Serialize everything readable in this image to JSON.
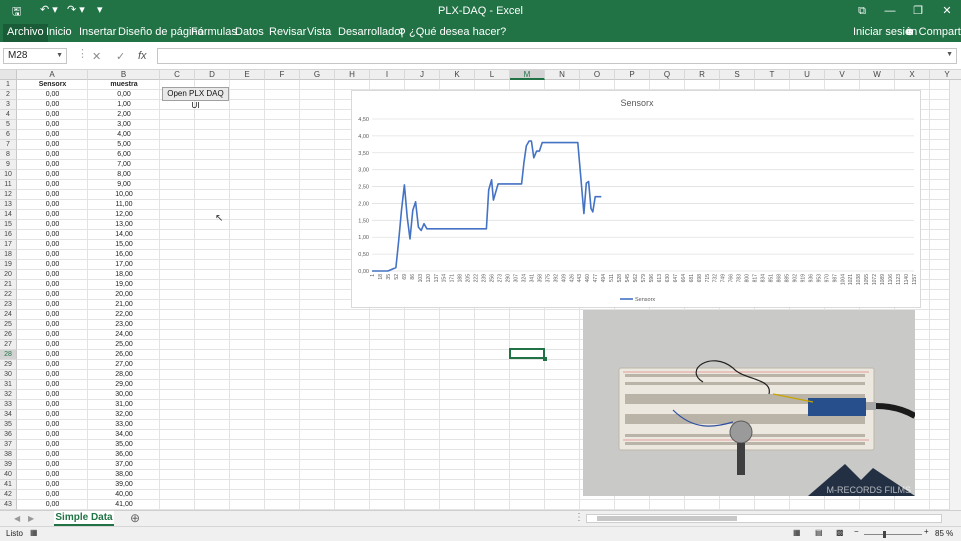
{
  "window": {
    "title": "PLX-DAQ - Excel"
  },
  "quick_access": {
    "save": "🖫",
    "undo": "↶ ▾",
    "redo": "↷ ▾",
    "customize": "▾"
  },
  "window_controls": {
    "ribbon_display": "⧉",
    "minimize": "—",
    "restore": "❐",
    "close": "✕"
  },
  "ribbon": {
    "tabs": [
      "Archivo",
      "Inicio",
      "Insertar",
      "Diseño de página",
      "Fórmulas",
      "Datos",
      "Revisar",
      "Vista",
      "Desarrollador"
    ],
    "tell_me": "¿Qué desea hacer?",
    "sign_in": "Iniciar sesión",
    "share": "Compartir"
  },
  "formula_bar": {
    "name_box": "M28",
    "cancel": "✕",
    "enter": "✓",
    "fx": "fx",
    "value": ""
  },
  "columns": [
    "A",
    "B",
    "C",
    "D",
    "E",
    "F",
    "G",
    "H",
    "I",
    "J",
    "K",
    "L",
    "M",
    "N",
    "O",
    "P",
    "Q",
    "R",
    "S",
    "T",
    "U",
    "V",
    "W",
    "X",
    "Y"
  ],
  "selected_column": "M",
  "selected_row": 28,
  "headers": {
    "a": "Sensorx",
    "b": "muestra"
  },
  "rows_a": [
    "0,00",
    "0,00",
    "0,00",
    "0,00",
    "0,00",
    "0,00",
    "0,00",
    "0,00",
    "0,00",
    "0,00",
    "0,00",
    "0,00",
    "0,00",
    "0,00",
    "0,00",
    "0,00",
    "0,00",
    "0,00",
    "0,00",
    "0,00",
    "0,00",
    "0,00",
    "0,00",
    "0,00",
    "0,00",
    "0,00",
    "0,00",
    "0,00",
    "0,00",
    "0,00",
    "0,00",
    "0,00",
    "0,00",
    "0,00",
    "0,00",
    "0,00",
    "0,00",
    "0,00",
    "0,00",
    "0,00",
    "0,00",
    "0,00"
  ],
  "rows_b": [
    "0,00",
    "1,00",
    "2,00",
    "3,00",
    "4,00",
    "5,00",
    "6,00",
    "7,00",
    "8,00",
    "9,00",
    "10,00",
    "11,00",
    "12,00",
    "13,00",
    "14,00",
    "15,00",
    "16,00",
    "17,00",
    "18,00",
    "19,00",
    "20,00",
    "21,00",
    "22,00",
    "23,00",
    "24,00",
    "25,00",
    "26,00",
    "27,00",
    "28,00",
    "29,00",
    "30,00",
    "31,00",
    "32,00",
    "33,00",
    "34,00",
    "35,00",
    "36,00",
    "37,00",
    "38,00",
    "39,00",
    "40,00",
    "41,00"
  ],
  "button": {
    "label": "Open PLX DAQ UI"
  },
  "chart_data": {
    "type": "line",
    "title": "Sensorx",
    "ylim": [
      0,
      4.5
    ],
    "yticks": [
      "0,00",
      "0,50",
      "1,00",
      "1,50",
      "2,00",
      "2,50",
      "3,00",
      "3,50",
      "4,00",
      "4,50"
    ],
    "x": [
      "1",
      "18",
      "35",
      "52",
      "69",
      "86",
      "103",
      "120",
      "137",
      "154",
      "171",
      "188",
      "205",
      "222",
      "239",
      "256",
      "273",
      "290",
      "307",
      "324",
      "341",
      "358",
      "375",
      "392",
      "409",
      "426",
      "443",
      "460",
      "477",
      "494",
      "511",
      "528",
      "545",
      "562",
      "579",
      "596",
      "613",
      "630",
      "647",
      "664",
      "681",
      "698",
      "715",
      "732",
      "749",
      "766",
      "783",
      "800",
      "817",
      "834",
      "851",
      "868",
      "885",
      "902",
      "919",
      "936",
      "953",
      "970",
      "987",
      "1004",
      "1021",
      "1038",
      "1055",
      "1072",
      "1089",
      "1106",
      "1123",
      "1140",
      "1157"
    ],
    "series": [
      {
        "name": "Sensorx",
        "x": [
          1,
          35,
          52,
          58,
          64,
          70,
          76,
          82,
          88,
          94,
          100,
          106,
          112,
          118,
          124,
          130,
          136,
          142,
          180,
          230,
          245,
          250,
          256,
          260,
          270,
          300,
          320,
          325,
          330,
          336,
          341,
          346,
          352,
          358,
          364,
          370,
          380,
          395,
          410,
          425,
          440,
          448,
          453,
          458,
          463,
          468,
          472,
          477,
          483,
          490
        ],
        "y": [
          0,
          0,
          0.1,
          0.9,
          1.8,
          2.55,
          1.6,
          0.95,
          1.8,
          2.05,
          1.3,
          1.2,
          1.4,
          1.25,
          1.25,
          1.25,
          1.25,
          1.25,
          1.25,
          1.25,
          1.25,
          2.4,
          2.7,
          2.1,
          2.58,
          2.58,
          2.58,
          3.2,
          3.7,
          3.85,
          3.85,
          3.35,
          3.55,
          3.55,
          3.8,
          3.8,
          3.8,
          3.8,
          3.8,
          3.8,
          3.8,
          2.5,
          1.7,
          2.6,
          2.65,
          1.85,
          1.75,
          2.2,
          2.2,
          2.2
        ]
      }
    ],
    "legend": "bottom",
    "color": "#4472c4"
  },
  "video": {
    "watermark": "M-RECORDS FILMS"
  },
  "sheet_tabs": {
    "active": "Simple Data",
    "add": "⊕"
  },
  "status": {
    "ready": "Listo",
    "zoom": "85 %",
    "zoom_minus": "−",
    "zoom_plus": "+"
  }
}
